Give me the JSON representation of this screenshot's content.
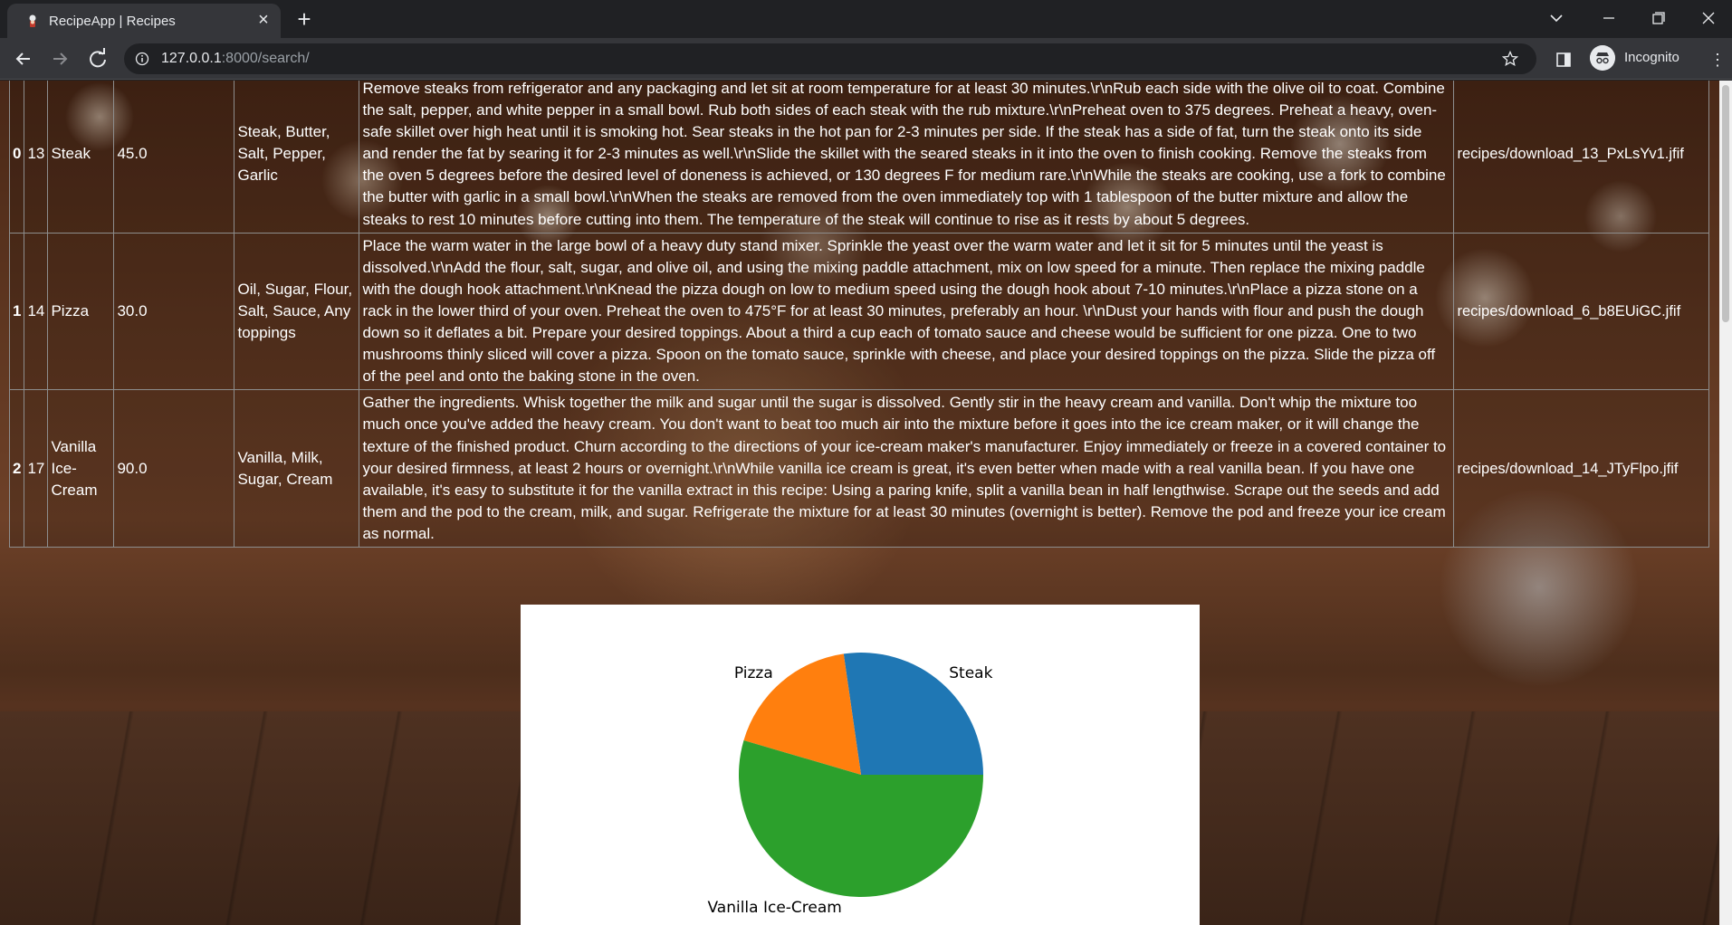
{
  "browser": {
    "tab_title": "RecipeApp | Recipes",
    "url_host": "127.0.0.1",
    "url_path": ":8000/search/",
    "incognito_label": "Incognito"
  },
  "table": {
    "rows": [
      {
        "index": "0",
        "id": "13",
        "name": "Steak",
        "cooking_time": "45.0",
        "ingredients": "Steak, Butter, Salt, Pepper, Garlic",
        "instructions": "Remove steaks from refrigerator and any packaging and let sit at room temperature for at least 30 minutes.\\r\\nRub each side with the olive oil to coat. Combine the salt, pepper, and white pepper in a small bowl. Rub both sides of each steak with the rub mixture.\\r\\nPreheat oven to 375 degrees. Preheat a heavy, oven-safe skillet over high heat until it is smoking hot. Sear steaks in the hot pan for 2-3 minutes per side. If the steak has a side of fat, turn the steak onto its side and render the fat by searing it for 2-3 minutes as well.\\r\\nSlide the skillet with the seared steaks in it into the oven to finish cooking. Remove the steaks from the oven 5 degrees before the desired level of doneness is achieved, or 130 degrees F for medium rare.\\r\\nWhile the steaks are cooking, use a fork to combine the butter with garlic in a small bowl.\\r\\nWhen the steaks are removed from the oven immediately top with 1 tablespoon of the butter mixture and allow the steaks to rest 10 minutes before cutting into them. The temperature of the steak will continue to rise as it rests by about 5 degrees.",
        "image": "recipes/download_13_PxLsYv1.jfif"
      },
      {
        "index": "1",
        "id": "14",
        "name": "Pizza",
        "cooking_time": "30.0",
        "ingredients": "Oil, Sugar, Flour, Salt, Sauce, Any toppings",
        "instructions": "Place the warm water in the large bowl of a heavy duty stand mixer. Sprinkle the yeast over the warm water and let it sit for 5 minutes until the yeast is dissolved.\\r\\nAdd the flour, salt, sugar, and olive oil, and using the mixing paddle attachment, mix on low speed for a minute. Then replace the mixing paddle with the dough hook attachment.\\r\\nKnead the pizza dough on low to medium speed using the dough hook about 7-10 minutes.\\r\\nPlace a pizza stone on a rack in the lower third of your oven. Preheat the oven to 475°F for at least 30 minutes, preferably an hour. \\r\\nDust your hands with flour and push the dough down so it deflates a bit. Prepare your desired toppings. About a third a cup each of tomato sauce and cheese would be sufficient for one pizza. One to two mushrooms thinly sliced will cover a pizza. Spoon on the tomato sauce, sprinkle with cheese, and place your desired toppings on the pizza. Slide the pizza off of the peel and onto the baking stone in the oven.",
        "image": "recipes/download_6_b8EUiGC.jfif"
      },
      {
        "index": "2",
        "id": "17",
        "name": "Vanilla Ice-Cream",
        "cooking_time": "90.0",
        "ingredients": "Vanilla, Milk, Sugar, Cream",
        "instructions": "Gather the ingredients. Whisk together the milk and sugar until the sugar is dissolved. Gently stir in the heavy cream and vanilla. Don't whip the mixture too much once you've added the heavy cream. You don't want to beat too much air into the mixture before it goes into the ice cream maker, or it will change the texture of the finished product. Churn according to the directions of your ice-cream maker's manufacturer. Enjoy immediately or freeze in a covered container to your desired firmness, at least 2 hours or overnight.\\r\\nWhile vanilla ice cream is great, it's even better when made with a real vanilla bean. If you have one available, it's easy to substitute it for the vanilla extract in this recipe: Using a paring knife, split a vanilla bean in half lengthwise. Scrape out the seeds and add them and the pod to the cream, milk, and sugar. Refrigerate the mixture for at least 30 minutes (overnight is better). Remove the pod and freeze your ice cream as normal.",
        "image": "recipes/download_14_JTyFlpo.jfif"
      }
    ]
  },
  "chart_data": {
    "type": "pie",
    "categories": [
      "Steak",
      "Pizza",
      "Vanilla Ice-Cream"
    ],
    "values": [
      45.0,
      30.0,
      90.0
    ],
    "colors": [
      "#1f77b4",
      "#ff7f0e",
      "#2ca02c"
    ],
    "start_angle_deg": 0,
    "direction": "counterclockwise"
  },
  "icons": {
    "favicon": "chef-icon",
    "nav": [
      "back-arrow-icon",
      "forward-arrow-icon",
      "reload-icon"
    ],
    "omnibox": [
      "info-icon",
      "star-icon"
    ],
    "toolbar": [
      "side-panel-icon",
      "incognito-icon",
      "kebab-menu-icon"
    ]
  }
}
